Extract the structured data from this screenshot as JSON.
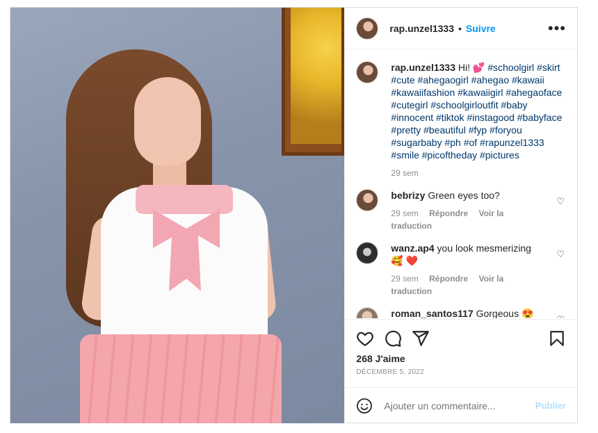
{
  "header": {
    "username": "rap.unzel1333",
    "separator": "•",
    "follow_label": "Suivre",
    "more_icon": "more-horizontal-icon"
  },
  "caption": {
    "username": "rap.unzel1333",
    "text": "Hi! 💕",
    "hashtags": "#schoolgirl #skirt #cute #ahegaogirl #ahegao #kawaii #kawaiifashion #kawaiigirl #ahegaoface #cutegirl #schoolgirloutfit #baby #innocent #tiktok #instagood #babyface #pretty #beautiful #fyp #foryou #sugarbaby #ph #of #rapunzel1333 #smile #picoftheday #pictures",
    "time": "29 sem"
  },
  "comments": [
    {
      "username": "bebrizy",
      "text": "Green eyes too?",
      "time": "29 sem",
      "reply_label": "Répondre",
      "translate_label": "Voir la traduction"
    },
    {
      "username": "wanz.ap4",
      "text": "you look mesmerizing 🥰 ❤️",
      "time": "29 sem",
      "reply_label": "Répondre",
      "translate_label": "Voir la traduction"
    },
    {
      "username": "roman_santos117",
      "text": "Gorgeous 😍🔥",
      "time": "",
      "reply_label": "",
      "translate_label": ""
    }
  ],
  "actions": {
    "icons": [
      "heart-icon",
      "comment-icon",
      "share-icon",
      "bookmark-icon"
    ],
    "likes": "268 J'aime",
    "date": "DÉCEMBRE 5, 2022"
  },
  "add_comment": {
    "placeholder": "Ajouter un commentaire...",
    "publish_label": "Publier",
    "emoji_icon": "emoji-icon"
  },
  "colors": {
    "accent": "#0095f6",
    "hashtag": "#00376b",
    "muted": "#8e8e8e",
    "publish_disabled": "#b2dffc"
  }
}
